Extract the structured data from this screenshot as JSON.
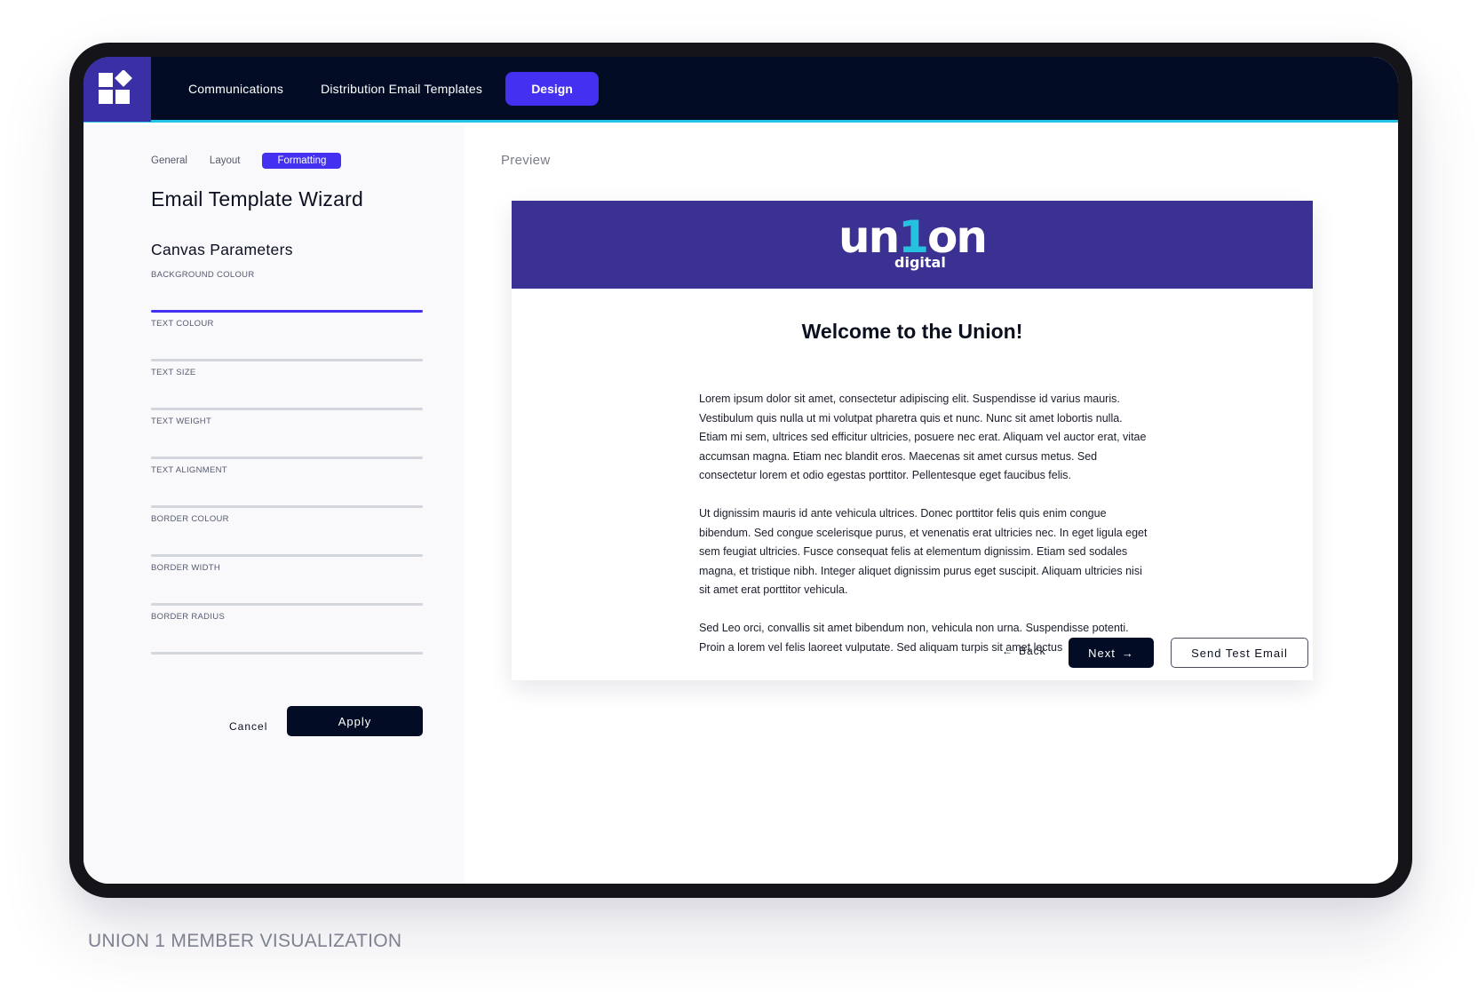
{
  "nav": {
    "items": [
      "Communications",
      "Distribution Email Templates"
    ],
    "active": "Design"
  },
  "sidebar": {
    "tabs": [
      "General",
      "Layout"
    ],
    "active_tab": "Formatting",
    "title": "Email Template Wizard",
    "section_title": "Canvas Parameters",
    "fields": [
      {
        "label": "BACKGROUND COLOUR"
      },
      {
        "label": "TEXT COLOUR"
      },
      {
        "label": "TEXT SIZE"
      },
      {
        "label": "TEXT WEIGHT"
      },
      {
        "label": "TEXT ALIGNMENT"
      },
      {
        "label": "BORDER COLOUR"
      },
      {
        "label": "BORDER WIDTH"
      },
      {
        "label": "BORDER RADIUS"
      }
    ],
    "cancel_label": "Cancel",
    "apply_label": "Apply"
  },
  "preview": {
    "label": "Preview",
    "brand": {
      "prefix": "un",
      "one": "1",
      "suffix": "on",
      "sub": "digital"
    },
    "heading": "Welcome to the Union!",
    "paragraphs": [
      "Lorem ipsum dolor sit amet, consectetur adipiscing elit. Suspendisse id varius mauris. Vestibulum quis nulla ut mi volutpat pharetra quis et nunc. Nunc sit amet lobortis nulla. Etiam mi sem, ultrices sed efficitur ultricies, posuere nec erat. Aliquam vel auctor erat, vitae accumsan magna. Etiam nec blandit eros. Maecenas sit amet cursus metus. Sed consectetur lorem et odio egestas porttitor. Pellentesque eget faucibus felis.",
      "Ut dignissim mauris id ante vehicula ultrices. Donec porttitor felis quis enim congue bibendum. Sed congue scelerisque purus, et venenatis erat ultricies nec. In eget ligula eget sem feugiat ultricies. Fusce consequat felis at elementum dignissim. Etiam sed sodales magna, et tristique nibh. Integer aliquet dignissim purus eget suscipit. Aliquam ultricies nisi sit amet erat porttitor vehicula.",
      "Sed Leo orci, convallis sit amet bibendum non, vehicula non urna. Suspendisse potenti. Proin a lorem vel felis laoreet vulputate. Sed aliquam turpis sit amet lectus"
    ]
  },
  "actions": {
    "back_label": "Back",
    "next_label": "Next",
    "send_label": "Send Test Email"
  },
  "caption": "UNION 1 MEMBER VISUALIZATION",
  "colors": {
    "nav_bg": "#020c24",
    "accent": "#4330f0",
    "brand_purple": "#3a3192",
    "brand_cyan": "#26c1de"
  }
}
